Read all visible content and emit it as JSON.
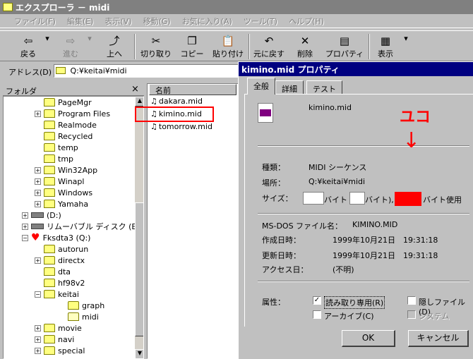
{
  "window": {
    "title": "エクスプローラ － midi"
  },
  "menu": [
    "ファイル(F)",
    "編集(E)",
    "表示(V)",
    "移動(G)",
    "お気に入り(A)",
    "ツール(T)",
    "ヘルプ(H)"
  ],
  "toolbar": {
    "back": "戻る",
    "forward": "進む",
    "up": "上へ",
    "cut": "切り取り",
    "copy": "コピー",
    "paste": "貼り付け",
    "undo": "元に戻す",
    "delete": "削除",
    "properties": "プロパティ",
    "view": "表示"
  },
  "address": {
    "label": "アドレス(D)",
    "value": "Q:¥keitai¥midi"
  },
  "folders": {
    "header": "フォルダ",
    "items": [
      "PageMgr",
      "Program Files",
      "Realmode",
      "Recycled",
      "temp",
      "tmp",
      "Win32App",
      "Winapl",
      "Windows",
      "Yamaha",
      "(D:)",
      "リムーバブル ディスク (E:)",
      "Fksdta3 (Q:)",
      "autorun",
      "directx",
      "dta",
      "hf98v2",
      "keitai",
      "graph",
      "midi",
      "movie",
      "navi",
      "special"
    ]
  },
  "files": {
    "header": "名前",
    "items": [
      "dakara.mid",
      "kimino.mid",
      "tomorrow.mid"
    ]
  },
  "dialog": {
    "title": "kimino.mid プロパティ",
    "tabs": [
      "全般",
      "詳細",
      "テスト"
    ],
    "filename": "kimino.mid",
    "type_label": "種類：",
    "type_value": "MIDI シーケンス",
    "location_label": "場所：",
    "location_value": "Q:¥keitai¥midi",
    "size_label": "サイズ：",
    "size_byte1": "バイト (",
    "size_byte2": "バイト),",
    "size_used": "バイト使用",
    "msdos_label": "MS-DOS ファイル名：",
    "msdos_value": "KIMINO.MID",
    "created_label": "作成日時：",
    "created_value": "1999年10月21日　19:31:18",
    "modified_label": "更新日時：",
    "modified_value": "1999年10月21日　19:31:18",
    "accessed_label": "アクセス日：",
    "accessed_value": "(不明)",
    "attr_label": "属性：",
    "readonly": "読み取り専用(R)",
    "hidden": "隠しファイル(D)",
    "archive": "アーカイブ(C)",
    "system": "システム",
    "ok": "OK",
    "cancel": "キャンセル"
  },
  "annotation": {
    "text": "ユコ",
    "arrow": "↓",
    "color": "#ff0000"
  }
}
